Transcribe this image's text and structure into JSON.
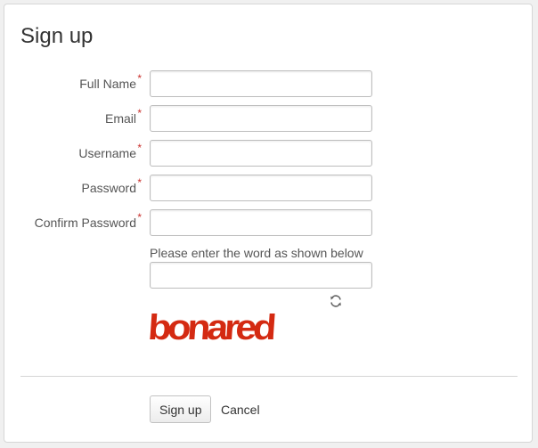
{
  "form": {
    "title": "Sign up",
    "fields": [
      {
        "label": "Full Name",
        "value": "",
        "placeholder": ""
      },
      {
        "label": "Email",
        "value": "",
        "placeholder": ""
      },
      {
        "label": "Username",
        "value": "",
        "placeholder": ""
      },
      {
        "label": "Password",
        "value": "",
        "placeholder": ""
      },
      {
        "label": "Confirm Password",
        "value": "",
        "placeholder": ""
      }
    ],
    "required_marker": "*",
    "captcha": {
      "prompt": "Please enter the word as shown below",
      "value": "",
      "word": "bonared",
      "word_color": "#d42a12"
    },
    "submit_label": "Sign up",
    "cancel_label": "Cancel"
  },
  "icons": {
    "refresh": "refresh-icon"
  }
}
